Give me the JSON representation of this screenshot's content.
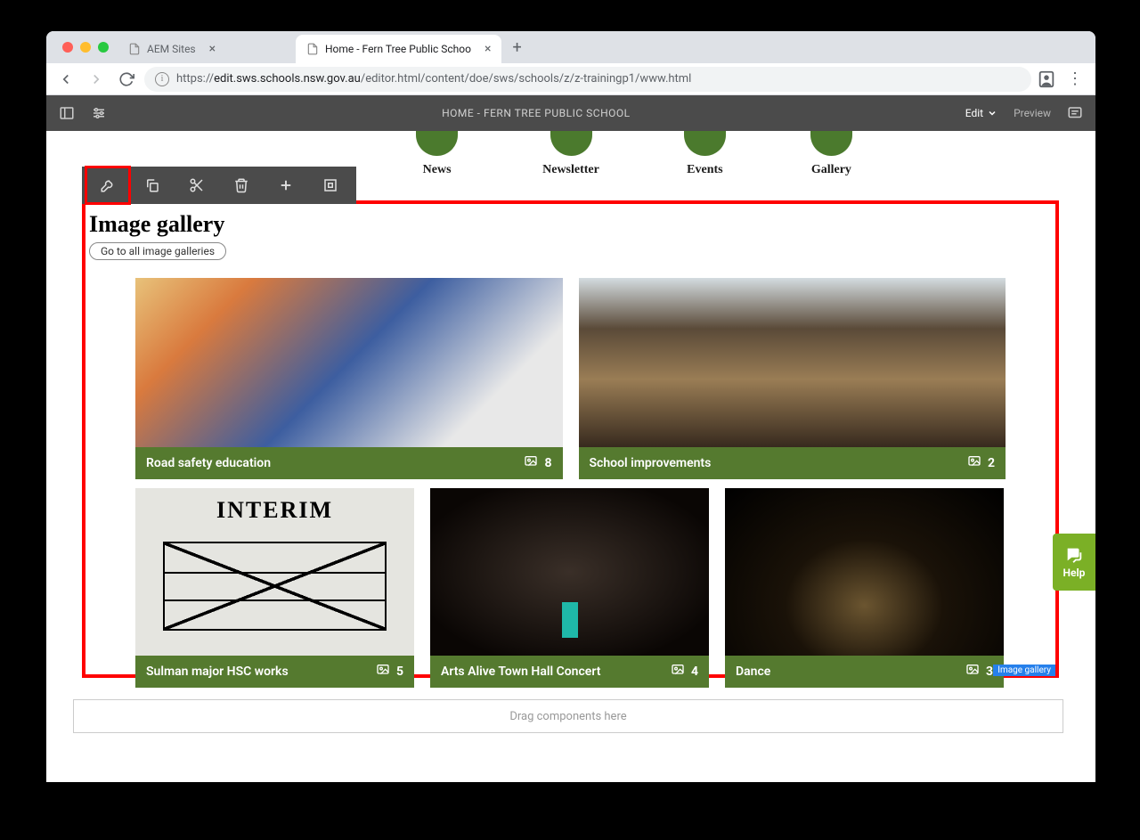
{
  "browser": {
    "tabs": [
      {
        "title": "AEM Sites",
        "active": false
      },
      {
        "title": "Home - Fern Tree Public Schoo",
        "active": true
      }
    ],
    "url_display": "https://edit.sws.schools.nsw.gov.au/editor.html/content/doe/sws/schools/z/z-trainingp1/www.html",
    "url_bold": "edit.sws.schools.nsw.gov.au"
  },
  "aem": {
    "title": "HOME - FERN TREE PUBLIC SCHOOL",
    "edit_label": "Edit",
    "preview_label": "Preview"
  },
  "quicklinks": [
    {
      "label": "News"
    },
    {
      "label": "Newsletter"
    },
    {
      "label": "Events"
    },
    {
      "label": "Gallery"
    }
  ],
  "gallery": {
    "heading": "Image gallery",
    "all_btn": "Go to all image galleries",
    "badge": "Image gallery",
    "row1": [
      {
        "title": "Road safety education",
        "count": "8"
      },
      {
        "title": "School improvements",
        "count": "2"
      }
    ],
    "row2": [
      {
        "title": "Sulman major HSC works",
        "count": "5"
      },
      {
        "title": "Arts Alive Town Hall Concert",
        "count": "4"
      },
      {
        "title": "Dance",
        "count": "3"
      }
    ],
    "interim_text": "INTERIM"
  },
  "dropzone": "Drag components here",
  "help_label": "Help"
}
